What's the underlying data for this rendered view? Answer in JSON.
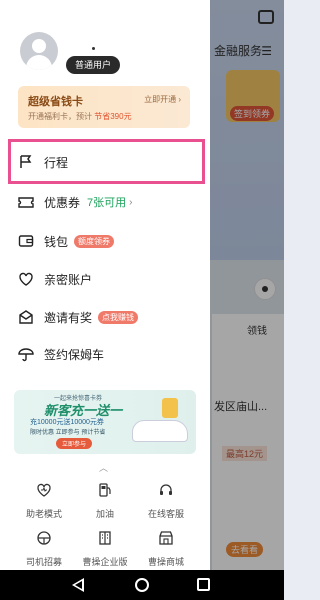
{
  "background": {
    "tab_label": "金融服务",
    "banner_button": "签到领券",
    "collect_label": "领钱",
    "address_text": "发区庙山...",
    "price_chip": "最高12元",
    "orange_button": "去看看"
  },
  "user": {
    "badge": "普通用户",
    "dot": "·"
  },
  "vip": {
    "title": "超级省钱卡",
    "open_label": "立即开通",
    "subtitle_prefix": "开通福利卡，预计 ",
    "subtitle_highlight": "节省390元"
  },
  "menu": {
    "trips": "行程",
    "coupons": "优惠券",
    "coupons_count": "7张可用",
    "wallet": "钱包",
    "wallet_tag": "额度领券",
    "family": "亲密账户",
    "invite": "邀请有奖",
    "invite_tag": "点我赚钱",
    "nanny": "签约保姆车"
  },
  "promo": {
    "tag": "一起来抢惊喜卡券",
    "title": "新客充一送一",
    "line1": "充10000元送10000元券",
    "line2": "限时优惠 立即参与 预计节省",
    "button": "立即参与"
  },
  "grid": {
    "elder_mode": "助老模式",
    "fuel": "加油",
    "online_service": "在线客服",
    "driver_recruit": "司机招募",
    "enterprise": "曹操企业版",
    "mall": "曹操商城"
  },
  "colors": {
    "highlight": "#e8508f",
    "green": "#1aa25a",
    "vip_title": "#8a4b16",
    "discount": "#e0542e"
  }
}
